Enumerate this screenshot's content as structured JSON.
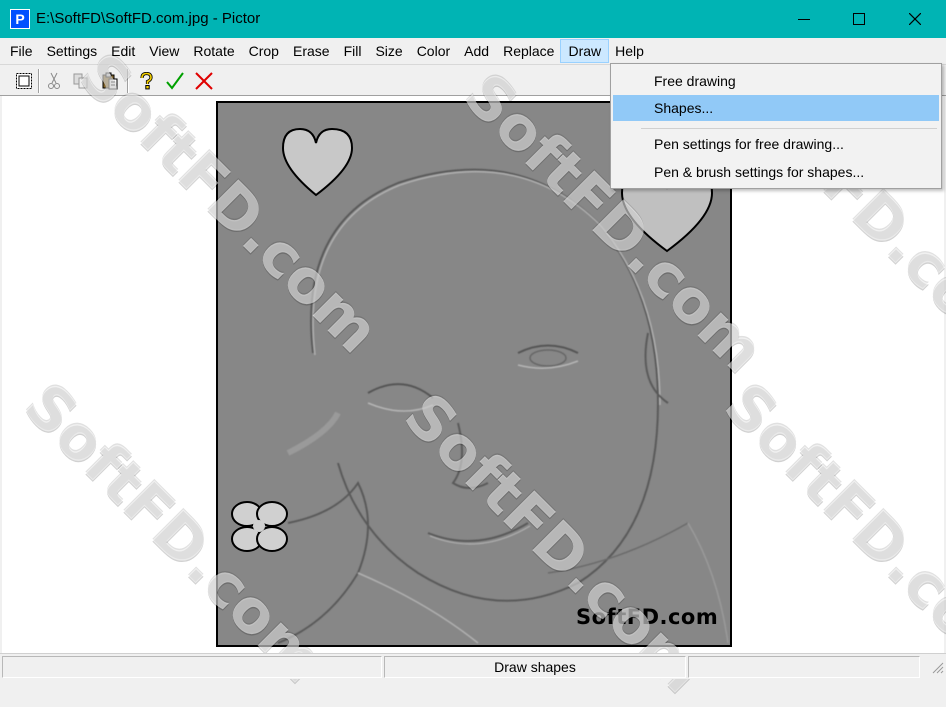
{
  "window": {
    "title": "E:\\SoftFD\\SoftFD.com.jpg - Pictor",
    "app_icon_letter": "P",
    "titlebar_color": "#00b4b4"
  },
  "menu": {
    "items": [
      "File",
      "Settings",
      "Edit",
      "View",
      "Rotate",
      "Crop",
      "Erase",
      "Fill",
      "Size",
      "Color",
      "Add",
      "Replace",
      "Draw",
      "Help"
    ],
    "active": "Draw"
  },
  "toolbar": {
    "icons": [
      "select-all-icon",
      "cut-icon",
      "copy-icon",
      "paste-icon",
      "help-icon",
      "apply-checkmark-icon",
      "cancel-x-icon"
    ]
  },
  "draw_menu": {
    "items": [
      {
        "label": "Free drawing",
        "highlighted": false
      },
      {
        "label": "Shapes...",
        "highlighted": true
      },
      {
        "label": "Pen settings for free drawing...",
        "highlighted": false
      },
      {
        "label": "Pen & brush settings for shapes...",
        "highlighted": false
      }
    ],
    "highlight_color": "#91c9f7"
  },
  "picture": {
    "caption": "SoftFD.com",
    "background": "#878787"
  },
  "watermark": "SoftFD.com",
  "status": {
    "text": "Draw shapes"
  }
}
